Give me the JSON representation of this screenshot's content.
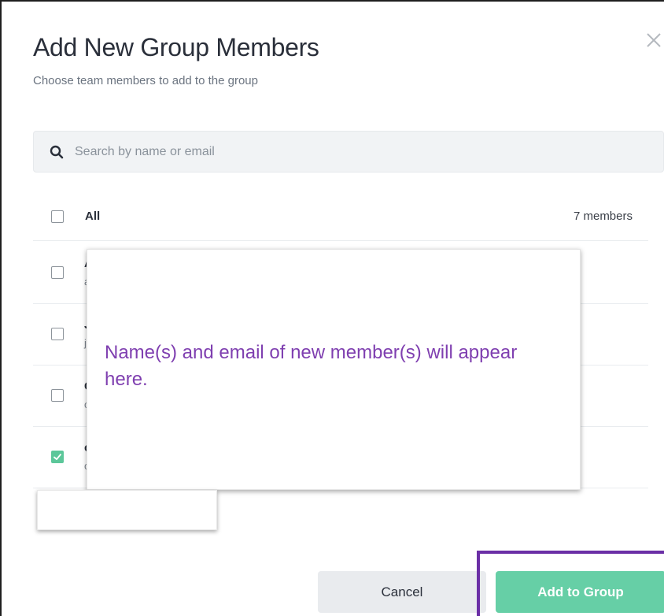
{
  "dialog": {
    "title": "Add New Group Members",
    "subtitle": "Choose team members to add to the group",
    "close_icon": "close-icon"
  },
  "search": {
    "placeholder": "Search by name or email",
    "value": "",
    "icon": "search-icon"
  },
  "select_all": {
    "label": "All",
    "count_label": "7 members",
    "checked": false
  },
  "members": [
    {
      "name": "A",
      "email": "a",
      "checked": false
    },
    {
      "name": "J",
      "email": "j",
      "checked": false
    },
    {
      "name": "C",
      "email": "c",
      "checked": false
    },
    {
      "name": "c",
      "email": "c",
      "checked": true
    }
  ],
  "overlay": {
    "message": "Name(s) and email of new member(s) will appear here."
  },
  "footer": {
    "cancel_label": "Cancel",
    "add_label": "Add to Group"
  },
  "colors": {
    "accent_green": "#66cfa6",
    "checkbox_green": "#5cc79a",
    "annotation_purple": "#7f3fb0",
    "highlight_border": "#6b2fa6",
    "title_text": "#2a2f3a"
  }
}
